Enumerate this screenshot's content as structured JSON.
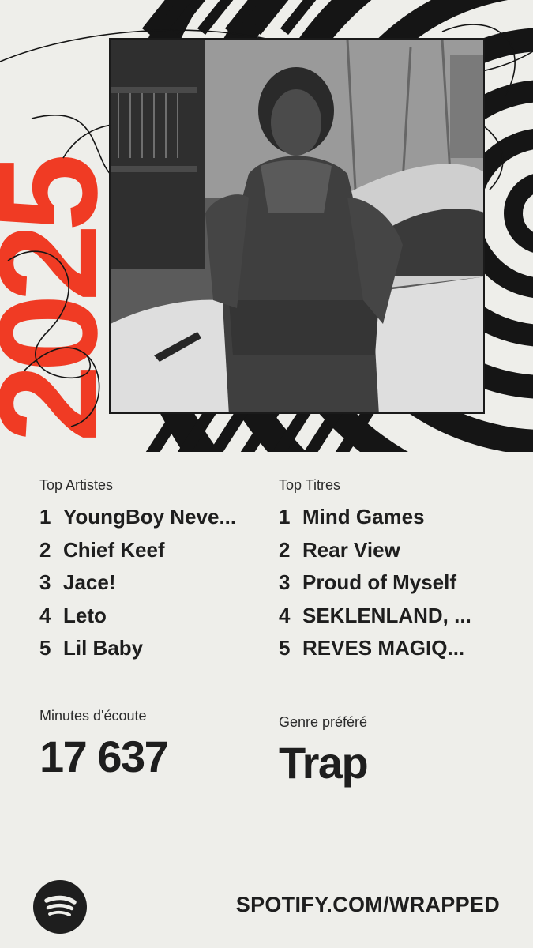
{
  "brand": {
    "year_text": "2025",
    "url": "SPOTIFY.COM/WRAPPED",
    "accent_color": "#f03b24",
    "ink_color": "#1e1e1e",
    "background_color": "#eeeeea"
  },
  "hero": {
    "logo_icon": "spotify-icon"
  },
  "top_artists": {
    "label": "Top Artistes",
    "items": [
      {
        "rank": "1",
        "name": "YoungBoy Neve..."
      },
      {
        "rank": "2",
        "name": "Chief Keef"
      },
      {
        "rank": "3",
        "name": "Jace!"
      },
      {
        "rank": "4",
        "name": "Leto"
      },
      {
        "rank": "5",
        "name": "Lil Baby"
      }
    ]
  },
  "top_tracks": {
    "label": "Top Titres",
    "items": [
      {
        "rank": "1",
        "name": "Mind Games"
      },
      {
        "rank": "2",
        "name": "Rear View"
      },
      {
        "rank": "3",
        "name": "Proud of Myself"
      },
      {
        "rank": "4",
        "name": "SEKLENLAND, ..."
      },
      {
        "rank": "5",
        "name": "REVES MAGIQ..."
      }
    ]
  },
  "minutes": {
    "label": "Minutes d'écoute",
    "value": "17 637"
  },
  "genre": {
    "label": "Genre préféré",
    "value": "Trap"
  }
}
